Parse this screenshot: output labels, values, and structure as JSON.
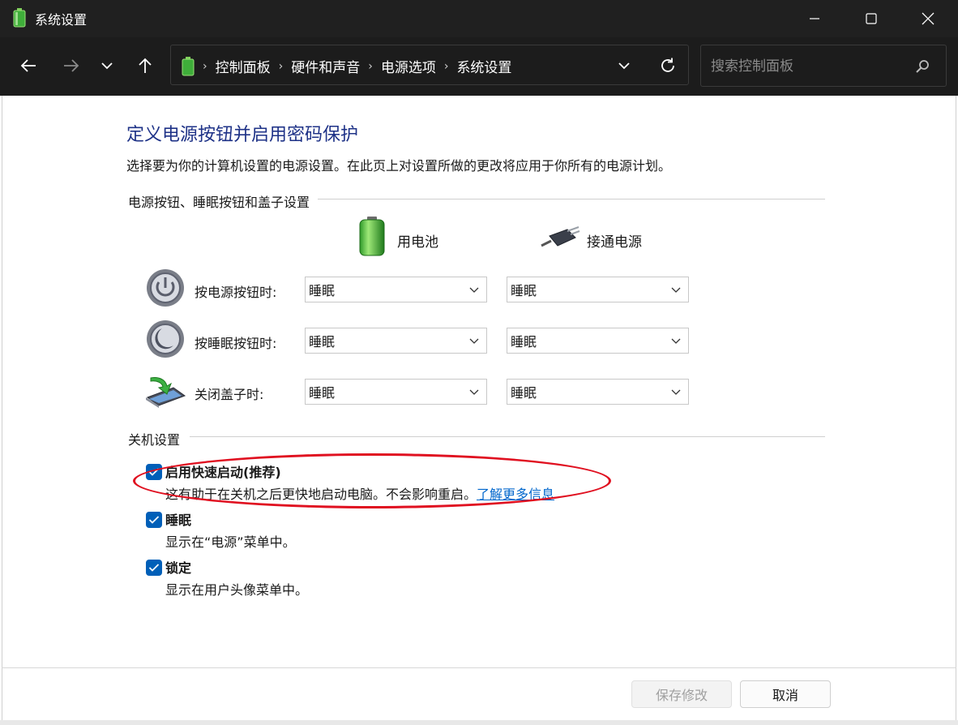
{
  "window": {
    "title": "系统设置"
  },
  "nav": {
    "breadcrumbs": [
      "控制面板",
      "硬件和声音",
      "电源选项",
      "系统设置"
    ],
    "search_placeholder": "搜索控制面板"
  },
  "page": {
    "title": "定义电源按钮并启用密码保护",
    "description": "选择要为你的计算机设置的电源设置。在此页上对设置所做的更改将应用于你所有的电源计划。"
  },
  "power_buttons": {
    "group_label": "电源按钮、睡眠按钮和盖子设置",
    "columns": [
      "用电池",
      "接通电源"
    ],
    "rows": [
      {
        "label": "按电源按钮时:",
        "battery": "睡眠",
        "plugged": "睡眠"
      },
      {
        "label": "按睡眠按钮时:",
        "battery": "睡眠",
        "plugged": "睡眠"
      },
      {
        "label": "关闭盖子时:",
        "battery": "睡眠",
        "plugged": "睡眠"
      }
    ]
  },
  "shutdown": {
    "group_label": "关机设置",
    "options": [
      {
        "title": "启用快速启动(推荐)",
        "description": "这有助于在关机之后更快地启动电脑。不会影响重启。",
        "link": "了解更多信息",
        "checked": true
      },
      {
        "title": "睡眠",
        "description": "显示在“电源”菜单中。",
        "checked": true
      },
      {
        "title": "锁定",
        "description": "显示在用户头像菜单中。",
        "checked": true
      }
    ]
  },
  "footer": {
    "save_label": "保存修改",
    "cancel_label": "取消"
  },
  "colors": {
    "accent": "#005fb8",
    "title_blue": "#1e3287",
    "highlight_red": "#e01020",
    "titlebar": "#202020"
  }
}
